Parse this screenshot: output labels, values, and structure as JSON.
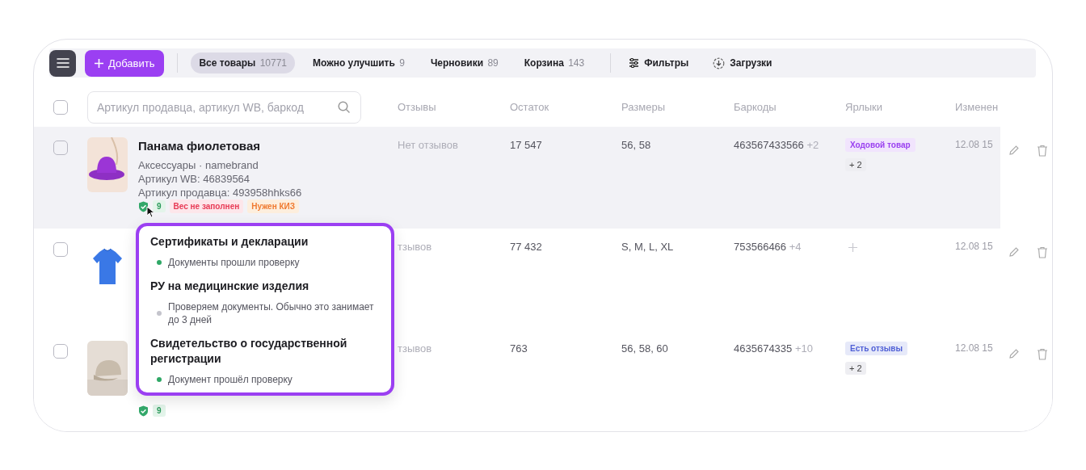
{
  "toolbar": {
    "add_button": "Добавить",
    "tabs": [
      {
        "label": "Все товары",
        "count": "10771",
        "selected": true
      },
      {
        "label": "Можно улучшить",
        "count": "9",
        "selected": false
      },
      {
        "label": "Черновики",
        "count": "89",
        "selected": false
      },
      {
        "label": "Корзина",
        "count": "143",
        "selected": false
      }
    ],
    "filters_button": "Фильтры",
    "downloads_button": "Загрузки"
  },
  "table": {
    "select_all_checked": false,
    "search": {
      "placeholder": "Артикул продавца, артикул WB, баркод"
    },
    "columns": [
      "Отзывы",
      "Остаток",
      "Размеры",
      "Баркоды",
      "Ярлыки",
      "Изменен"
    ],
    "rows": [
      {
        "checked": false,
        "highlighted": true,
        "name": "Панама фиолетовая",
        "details": [
          "Аксессуары · namebrand",
          "Артикул WB: 46839564",
          "Артикул продавца: 493958hhks66"
        ],
        "verified": true,
        "doc_count": "9",
        "tags": [
          {
            "text": "Вес не заполнен",
            "kind": "error"
          },
          {
            "text": "Нужен КИЗ",
            "kind": "warning"
          }
        ],
        "reviews": "Нет отзывов",
        "stock": "17 547",
        "sizes": "56, 58",
        "barcode": "463567433566",
        "barcode_more": "+2",
        "labels": [
          {
            "text": "Ходовой товар",
            "color": "#9a3ff0"
          }
        ],
        "labels_more": "+ 2",
        "changed": "12.08 15"
      },
      {
        "checked": false,
        "highlighted": false,
        "details": [],
        "tags": [],
        "reviews": "тзывов",
        "stock": "77 432",
        "sizes": "S, M, L, XL",
        "barcode": "753566466",
        "barcode_more": "+4",
        "labels": [],
        "changed": "12.08 15"
      },
      {
        "checked": false,
        "highlighted": false,
        "details": [],
        "verified": true,
        "doc_count": "9",
        "tags": [],
        "reviews": "тзывов",
        "stock": "763",
        "sizes": "56, 58, 60",
        "barcode": "4635674335",
        "barcode_more": "+10",
        "labels": [
          {
            "text": "Есть отзывы",
            "color": "#4f5fd6"
          }
        ],
        "labels_more": "+ 2",
        "changed": "12.08 15"
      }
    ]
  },
  "popover": {
    "sections": [
      {
        "title": "Сертификаты и декларации",
        "status": "Документы прошли проверку",
        "color": "#2fa866"
      },
      {
        "title": "РУ на медицинские изделия",
        "status": "Проверяем документы. Обычно это занимает до 3 дней",
        "color": "#c4c4cc"
      },
      {
        "title": "Свидетельство о государственной регистрации",
        "status": "Документ прошёл проверку",
        "color": "#2fa866"
      }
    ]
  }
}
